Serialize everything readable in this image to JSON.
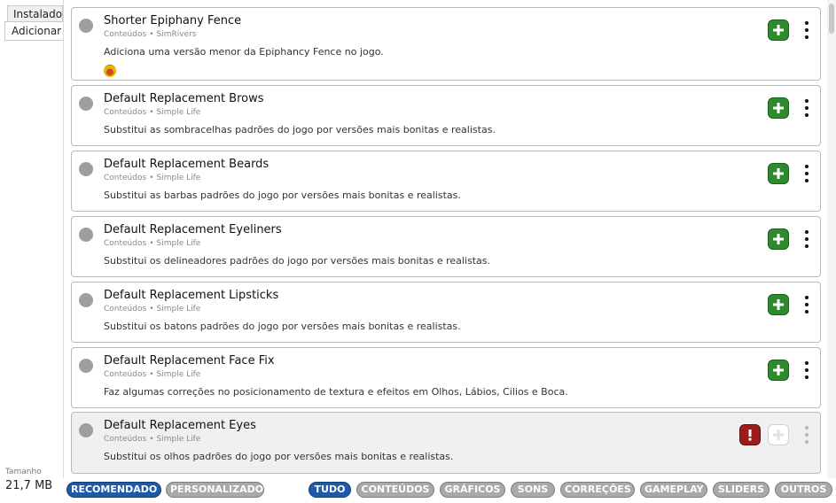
{
  "tabs": {
    "installed": "Instalado",
    "add": "Adicionar"
  },
  "size": {
    "label": "Tamanho",
    "value": "21,7 MB"
  },
  "items": [
    {
      "title": "Shorter Epiphany Fence",
      "category": "Conteúdos",
      "author": "SimRivers",
      "description": "Adiciona uma versão menor da Epiphancy Fence no jogo."
    },
    {
      "title": "Default Replacement Brows",
      "category": "Conteúdos",
      "author": "Simple Life",
      "description": "Substitui as sombracelhas padrões do jogo por versões mais bonitas e realistas."
    },
    {
      "title": "Default Replacement Beards",
      "category": "Conteúdos",
      "author": "Simple Life",
      "description": "Substitui as barbas padrões do jogo por versões mais bonitas e realistas."
    },
    {
      "title": "Default Replacement Eyeliners",
      "category": "Conteúdos",
      "author": "Simple Life",
      "description": "Substitui os delineadores padrões do jogo por versões mais bonitas e realistas."
    },
    {
      "title": "Default Replacement Lipsticks",
      "category": "Conteúdos",
      "author": "Simple Life",
      "description": "Substitui os batons padrões do jogo por versões mais bonitas e realistas."
    },
    {
      "title": "Default Replacement Face Fix",
      "category": "Conteúdos",
      "author": "Simple Life",
      "description": "Faz algumas correções no posicionamento de textura e efeitos em Olhos, Lábios, Cilios e Boca."
    },
    {
      "title": "Default Replacement Eyes",
      "category": "Conteúdos",
      "author": "Simple Life",
      "description": "Substitui os olhos padrões do jogo por versões mais bonitas e realistas."
    }
  ],
  "meta_separator": "•",
  "filters": {
    "recommended": "RECOMENDADO",
    "custom": "PERSONALIZADO",
    "all": "TUDO",
    "contents": "CONTEÚDOS",
    "graphics": "GRÁFICOS",
    "sounds": "SONS",
    "fixes": "CORREÇÕES",
    "gameplay": "GAMEPLAY",
    "sliders": "SLIDERS",
    "others": "OUTROS"
  },
  "colors": {
    "active_filter": "#1f5aa8",
    "inactive_filter": "#a9a9a9",
    "add_button": "#2d8a2d",
    "warning_button": "#9c1b1b"
  },
  "icons": {
    "add": "plus-icon",
    "warning": "exclamation-icon",
    "menu": "kebab-menu-icon",
    "status": "status-dot-icon"
  }
}
